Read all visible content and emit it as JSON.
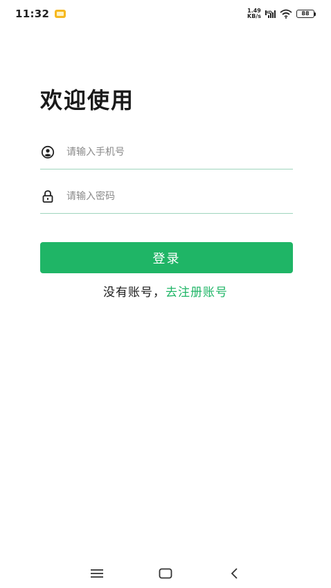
{
  "status_bar": {
    "time": "11:32",
    "net_speed_value": "1.49",
    "net_speed_unit": "KB/s",
    "network_type": "HD",
    "battery_level": "88"
  },
  "login": {
    "title": "欢迎使用",
    "phone_placeholder": "请输入手机号",
    "password_placeholder": "请输入密码",
    "login_button": "登录",
    "register_prompt": "没有账号，",
    "register_link": "去注册账号"
  },
  "colors": {
    "accent": "#1fb566",
    "field_underline": "#9fd5bd"
  },
  "icons": {
    "phone_field": "user-circle-icon",
    "password_field": "lock-icon",
    "nav_menu": "menu-icon",
    "nav_home": "home-square-icon",
    "nav_back": "back-chevron-icon"
  }
}
